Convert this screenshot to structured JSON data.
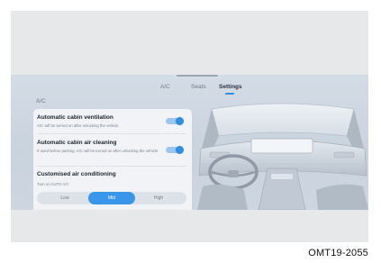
{
  "tabs": [
    {
      "label": "A/C",
      "active": false
    },
    {
      "label": "Seats",
      "active": false
    },
    {
      "label": "Settings",
      "active": true
    }
  ],
  "section_title": "A/C",
  "settings": {
    "ventilation": {
      "title": "Automatic cabin ventilation",
      "description": "A/C will be turned on after unlocking the vehicle",
      "enabled": true
    },
    "air_cleaning": {
      "title": "Automatic cabin air cleaning",
      "description": "If used before parking, A/C will be turned on after unlocking the vehicle",
      "enabled": true
    },
    "customised": {
      "title": "Customised air conditioning",
      "description": "Turn on AUTO A/C",
      "options": [
        "Low",
        "Mid",
        "High"
      ],
      "selected": "Mid"
    }
  },
  "caption": "OMT19-2055",
  "colors": {
    "accent": "#2f8de6",
    "panel": "#f1f3f6",
    "screen_bg": "#cfd7e1"
  }
}
